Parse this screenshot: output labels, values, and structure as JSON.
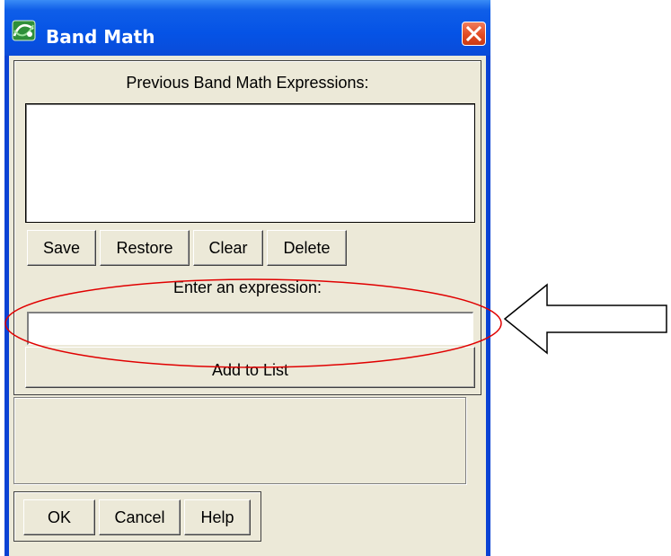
{
  "window": {
    "title": "Band Math",
    "title_icon": "band-math-app-icon",
    "close_icon": "close-x-icon"
  },
  "history": {
    "label": "Previous Band Math Expressions:",
    "items": []
  },
  "history_buttons": {
    "save": "Save",
    "restore": "Restore",
    "clear": "Clear",
    "delete": "Delete"
  },
  "expression": {
    "label": "Enter an expression:",
    "value": "",
    "add_label": "Add to List"
  },
  "status": {
    "text": ""
  },
  "dialog_buttons": {
    "ok": "OK",
    "cancel": "Cancel",
    "help": "Help"
  },
  "annotation": {
    "highlight_shape": "ellipse",
    "highlight_color": "#e00000",
    "pointer_shape": "arrow-left"
  },
  "colors": {
    "titlebar": "#0553e6",
    "dialog_face": "#ece9d8",
    "close_button": "#e24b24"
  }
}
